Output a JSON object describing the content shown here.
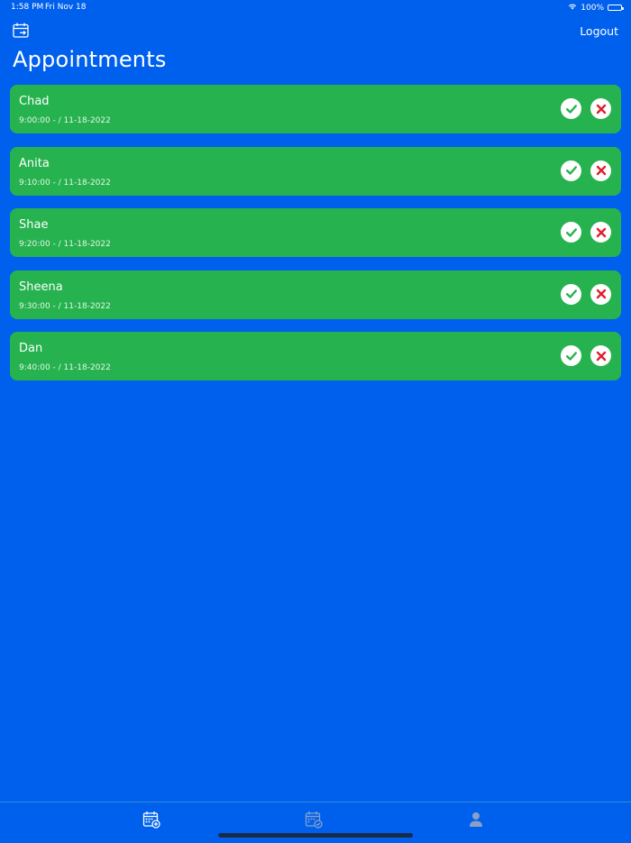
{
  "status_bar": {
    "time": "1:58 PM",
    "date": "Fri Nov 18",
    "battery": "100%",
    "icons": [
      "wifi-icon",
      "battery-icon"
    ]
  },
  "header": {
    "calendar_icon": "calendar-icon",
    "logout_label": "Logout",
    "title": "Appointments"
  },
  "appointments": [
    {
      "name": "Chad",
      "time": "9:00:00 -  / 11-18-2022"
    },
    {
      "name": "Anita",
      "time": "9:10:00 -  / 11-18-2022"
    },
    {
      "name": "Shae",
      "time": "9:20:00 -  / 11-18-2022"
    },
    {
      "name": "Sheena",
      "time": "9:30:00 -  / 11-18-2022"
    },
    {
      "name": "Dan",
      "time": "9:40:00 -  / 11-18-2022"
    }
  ],
  "actions": {
    "accept_icon": "checkmark-icon",
    "decline_icon": "x-icon"
  },
  "tab_bar": {
    "tabs": [
      {
        "icon": "calendar-add-icon",
        "selected": true
      },
      {
        "icon": "calendar-check-icon",
        "selected": false
      },
      {
        "icon": "person-icon",
        "selected": false
      }
    ]
  },
  "colors": {
    "background": "#0060EE",
    "card": "#26B24E",
    "accept": "#26B24E",
    "decline": "#E0202E",
    "tab_inactive": "#8aa0c8"
  }
}
